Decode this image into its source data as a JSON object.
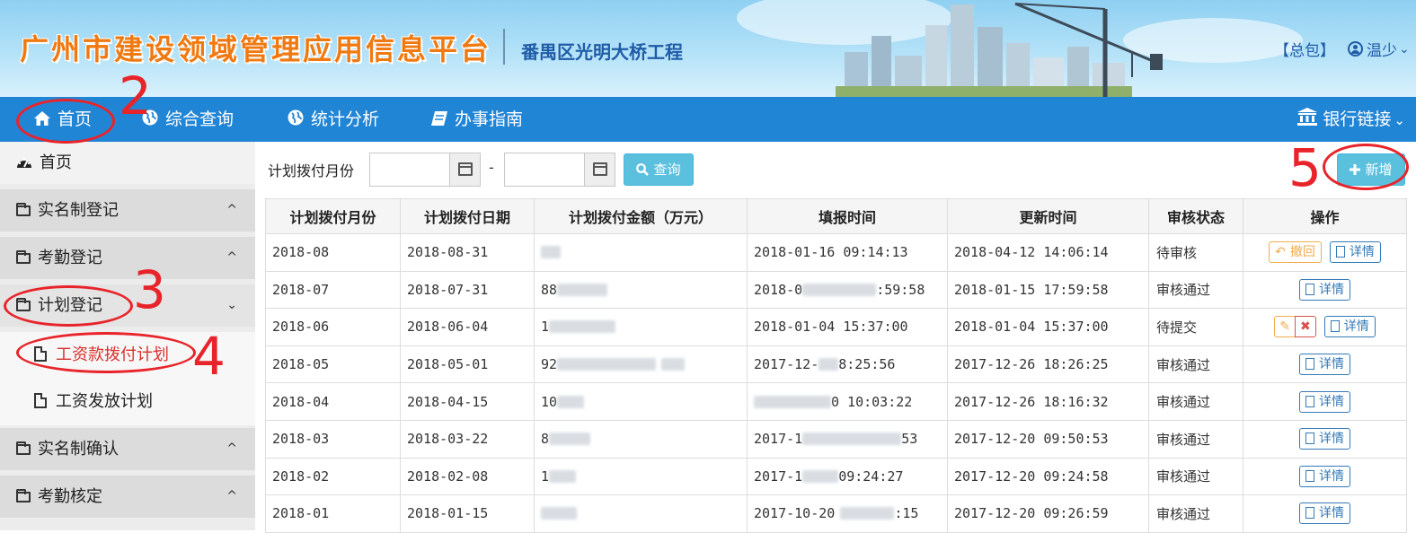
{
  "header": {
    "site_title": "广州市建设领域管理应用信息平台",
    "project_name": "番禺区光明大桥工程",
    "org_link": "【总包】",
    "user_name": "温少",
    "user_caret": "⌄"
  },
  "nav": {
    "items": [
      {
        "label": "首页",
        "icon": "home-icon"
      },
      {
        "label": "综合查询",
        "icon": "globe-icon"
      },
      {
        "label": "统计分析",
        "icon": "globe-icon"
      },
      {
        "label": "办事指南",
        "icon": "book-icon"
      }
    ],
    "bank_link": "银行链接",
    "bank_caret": "⌄"
  },
  "sidebar": {
    "dashboard": "首页",
    "groups": [
      {
        "label": "实名制登记",
        "chevron": "^"
      },
      {
        "label": "考勤登记",
        "chevron": "^"
      },
      {
        "label": "计划登记",
        "chevron": "⌄"
      },
      {
        "label": "实名制确认",
        "chevron": "^"
      },
      {
        "label": "考勤核定",
        "chevron": "^"
      }
    ],
    "sub_items": [
      {
        "label": "工资款拨付计划",
        "active": true
      },
      {
        "label": "工资发放计划",
        "active": false
      }
    ]
  },
  "toolbar": {
    "filter_label": "计划拨付月份",
    "dash": "-",
    "search_label": "查询",
    "add_label": "新增"
  },
  "table": {
    "columns": [
      "计划拨付月份",
      "计划拨付日期",
      "计划拨付金额（万元）",
      "填报时间",
      "更新时间",
      "审核状态",
      "操作"
    ],
    "rows": [
      {
        "month": "2018-08",
        "date": "2018-08-31",
        "amount": "",
        "filled": "2018-01-16 09:14:13",
        "updated": "2018-04-12 14:06:14",
        "status": "待审核",
        "ops": [
          "revoke",
          "detail"
        ]
      },
      {
        "month": "2018-07",
        "date": "2018-07-31",
        "amount": "88",
        "filled": "2018-0",
        "filled_tail": ":59:58",
        "updated": "2018-01-15 17:59:58",
        "status": "审核通过",
        "ops": [
          "detail"
        ]
      },
      {
        "month": "2018-06",
        "date": "2018-06-04",
        "amount": "1",
        "filled": "2018-01-04 15:37:00",
        "updated": "2018-01-04 15:37:00",
        "status": "待提交",
        "ops": [
          "edit",
          "delete",
          "detail"
        ]
      },
      {
        "month": "2018-05",
        "date": "2018-05-01",
        "amount": "92",
        "filled": "2017-12-",
        "filled_tail": "8:25:56",
        "updated": "2017-12-26 18:26:25",
        "status": "审核通过",
        "ops": [
          "detail"
        ]
      },
      {
        "month": "2018-04",
        "date": "2018-04-15",
        "amount": "10",
        "filled": "",
        "filled_tail": "0 10:03:22",
        "updated": "2017-12-26 18:16:32",
        "status": "审核通过",
        "ops": [
          "detail"
        ]
      },
      {
        "month": "2018-03",
        "date": "2018-03-22",
        "amount": "8",
        "filled": "2017-1",
        "filled_tail": "53",
        "updated": "2017-12-20 09:50:53",
        "status": "审核通过",
        "ops": [
          "detail"
        ]
      },
      {
        "month": "2018-02",
        "date": "2018-02-08",
        "amount": "1",
        "filled": "2017-1",
        "filled_tail": "09:24:27",
        "updated": "2017-12-20 09:24:58",
        "status": "审核通过",
        "ops": [
          "detail"
        ]
      },
      {
        "month": "2018-01",
        "date": "2018-01-15",
        "amount": "",
        "filled": "2017-10-20",
        "filled_tail": ":15",
        "updated": "2017-12-20 09:26:59",
        "status": "审核通过",
        "ops": [
          "detail"
        ]
      }
    ],
    "op_labels": {
      "revoke": "撤回",
      "detail": "详情",
      "edit": "✎",
      "delete": "✖"
    }
  },
  "annotations": [
    "2",
    "3",
    "4",
    "5"
  ],
  "colors": {
    "nav_bg": "#2185d6",
    "accent_red": "#e8242a",
    "info_btn": "#5bc0de",
    "title_orange": "#f07a12",
    "link_blue": "#1f5ca8"
  }
}
